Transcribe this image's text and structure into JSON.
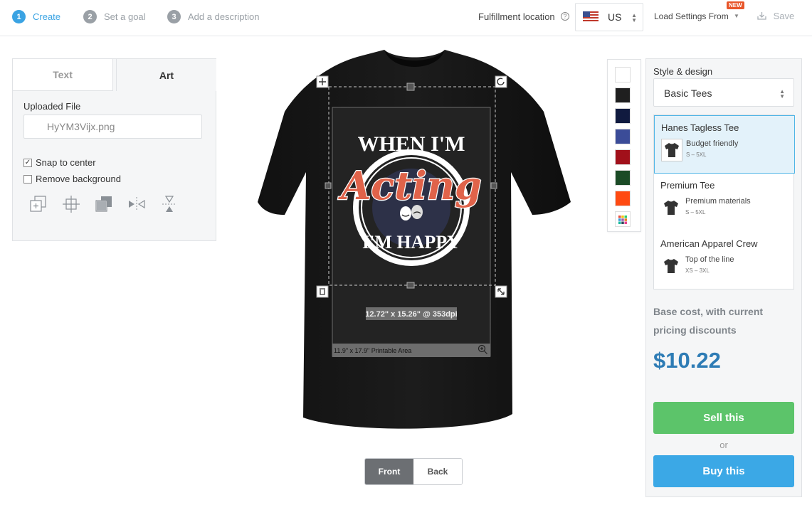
{
  "steps": [
    {
      "num": "1",
      "label": "Create"
    },
    {
      "num": "2",
      "label": "Set a goal"
    },
    {
      "num": "3",
      "label": "Add a description"
    }
  ],
  "header": {
    "fulfillment_label": "Fulfillment location",
    "help_icon": "?",
    "country_code": "US",
    "load_settings": "Load Settings From",
    "new_badge": "NEW",
    "save_label": "Save"
  },
  "left_panel": {
    "tab_text": "Text",
    "tab_art": "Art",
    "uploaded_file_label": "Uploaded File",
    "uploaded_file_value": "HyYM3Vijx.png",
    "snap_to_center": "Snap to center",
    "snap_checked": true,
    "remove_background": "Remove background",
    "remove_checked": false,
    "tools": [
      "bring-forward-icon",
      "center-crosshair-icon",
      "layer-stack-icon",
      "flip-horizontal-icon",
      "flip-vertical-icon"
    ]
  },
  "canvas": {
    "artwork_text_top": "WHEN I'M",
    "artwork_text_main": "Acting",
    "artwork_text_bottom": "I'M HAPPY",
    "dimensions": "12.72\" x 15.26\" @ 353dpi",
    "printable_area": "11.9\" x 17.9\" Printable Area",
    "view_front": "Front",
    "view_back": "Back"
  },
  "swatches": [
    "#ffffff",
    "#1f1f1f",
    "#101a3f",
    "#3b4c98",
    "#a1101a",
    "#1b4b26",
    "#ff4a11",
    "multicolor"
  ],
  "right_panel": {
    "style_label": "Style & design",
    "style_value": "Basic Tees",
    "products": [
      {
        "name": "Hanes Tagless Tee",
        "desc": "Budget friendly",
        "sizes": "S – 5XL",
        "selected": true
      },
      {
        "name": "Premium Tee",
        "desc": "Premium materials",
        "sizes": "S – 5XL",
        "selected": false
      },
      {
        "name": "American Apparel Crew",
        "desc": "Top of the line",
        "sizes": "XS – 3XL",
        "selected": false
      }
    ],
    "base_cost_label": "Base cost, with current pricing discounts",
    "price": "$10.22",
    "sell_label": "Sell this",
    "or_label": "or",
    "buy_label": "Buy this"
  },
  "colors": {
    "accent_blue": "#3aa3e3",
    "sell_green": "#5cc46a",
    "buy_blue": "#3ba8e6",
    "price_blue": "#2e7cb5",
    "new_badge": "#e8562a",
    "art_orange": "#e0634a"
  }
}
